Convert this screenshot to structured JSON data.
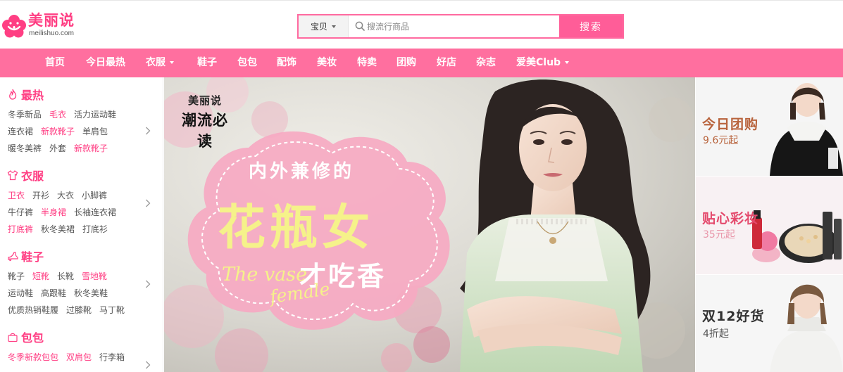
{
  "header": {
    "logo_cn": "美丽说",
    "logo_en": "meilishuo.com",
    "search": {
      "category": "宝贝",
      "placeholder": "搜流行商品",
      "button": "搜索"
    }
  },
  "nav": {
    "items": [
      {
        "label": "首页"
      },
      {
        "label": "今日最热"
      },
      {
        "label": "衣服"
      },
      {
        "label": "鞋子"
      },
      {
        "label": "包包"
      },
      {
        "label": "配饰"
      },
      {
        "label": "美妆"
      },
      {
        "label": "特卖"
      },
      {
        "label": "团购"
      },
      {
        "label": "好店"
      },
      {
        "label": "杂志"
      },
      {
        "label": "爱美Club"
      }
    ]
  },
  "sidebar": {
    "categories": [
      {
        "title": "最热",
        "icon": "flame-icon",
        "rows": [
          [
            "冬季新品",
            "毛衣",
            "活力运动鞋"
          ],
          [
            "连衣裙",
            "新款靴子",
            "单肩包"
          ],
          [
            "暖冬美裤",
            "外套",
            "新款靴子"
          ]
        ],
        "hot": [
          [
            1
          ],
          [
            1
          ],
          [
            2
          ]
        ]
      },
      {
        "title": "衣服",
        "icon": "shirt-icon",
        "rows": [
          [
            "卫衣",
            "开衫",
            "大衣",
            "小脚裤"
          ],
          [
            "牛仔裤",
            "半身裙",
            "长袖连衣裙"
          ],
          [
            "打底裤",
            "秋冬美裙",
            "打底衫"
          ]
        ],
        "hot": [
          [
            0
          ],
          [
            1
          ],
          [
            0
          ]
        ]
      },
      {
        "title": "鞋子",
        "icon": "heel-icon",
        "rows": [
          [
            "靴子",
            "短靴",
            "长靴",
            "雪地靴"
          ],
          [
            "运动鞋",
            "高跟鞋",
            "秋冬美鞋"
          ],
          [
            "优质热销鞋履",
            "过膝靴",
            "马丁靴"
          ]
        ],
        "hot": [
          [
            1,
            3
          ],
          [],
          []
        ]
      },
      {
        "title": "包包",
        "icon": "bag-icon",
        "rows": [
          [
            "冬季新款包包",
            "双肩包",
            "行李箱"
          ]
        ],
        "hot": [
          [
            0,
            1
          ]
        ]
      }
    ]
  },
  "banner": {
    "badge_top": "美丽说",
    "badge_main": "潮流必读",
    "headline_top": "内外兼修的",
    "headline_main": "花瓶女",
    "headline_bottom": "才吃香",
    "script_en_1": "The vase",
    "script_en_2": "female"
  },
  "promos": [
    {
      "title": "今日团购",
      "sub": "9.6元起"
    },
    {
      "title": "贴心彩妆",
      "sub": "35元起"
    },
    {
      "title": "双12好货",
      "sub": "4折起"
    }
  ],
  "colors": {
    "brand_pink": "#ff3e83",
    "nav_pink": "#ff6f9f",
    "search_button": "#ff5d98"
  }
}
